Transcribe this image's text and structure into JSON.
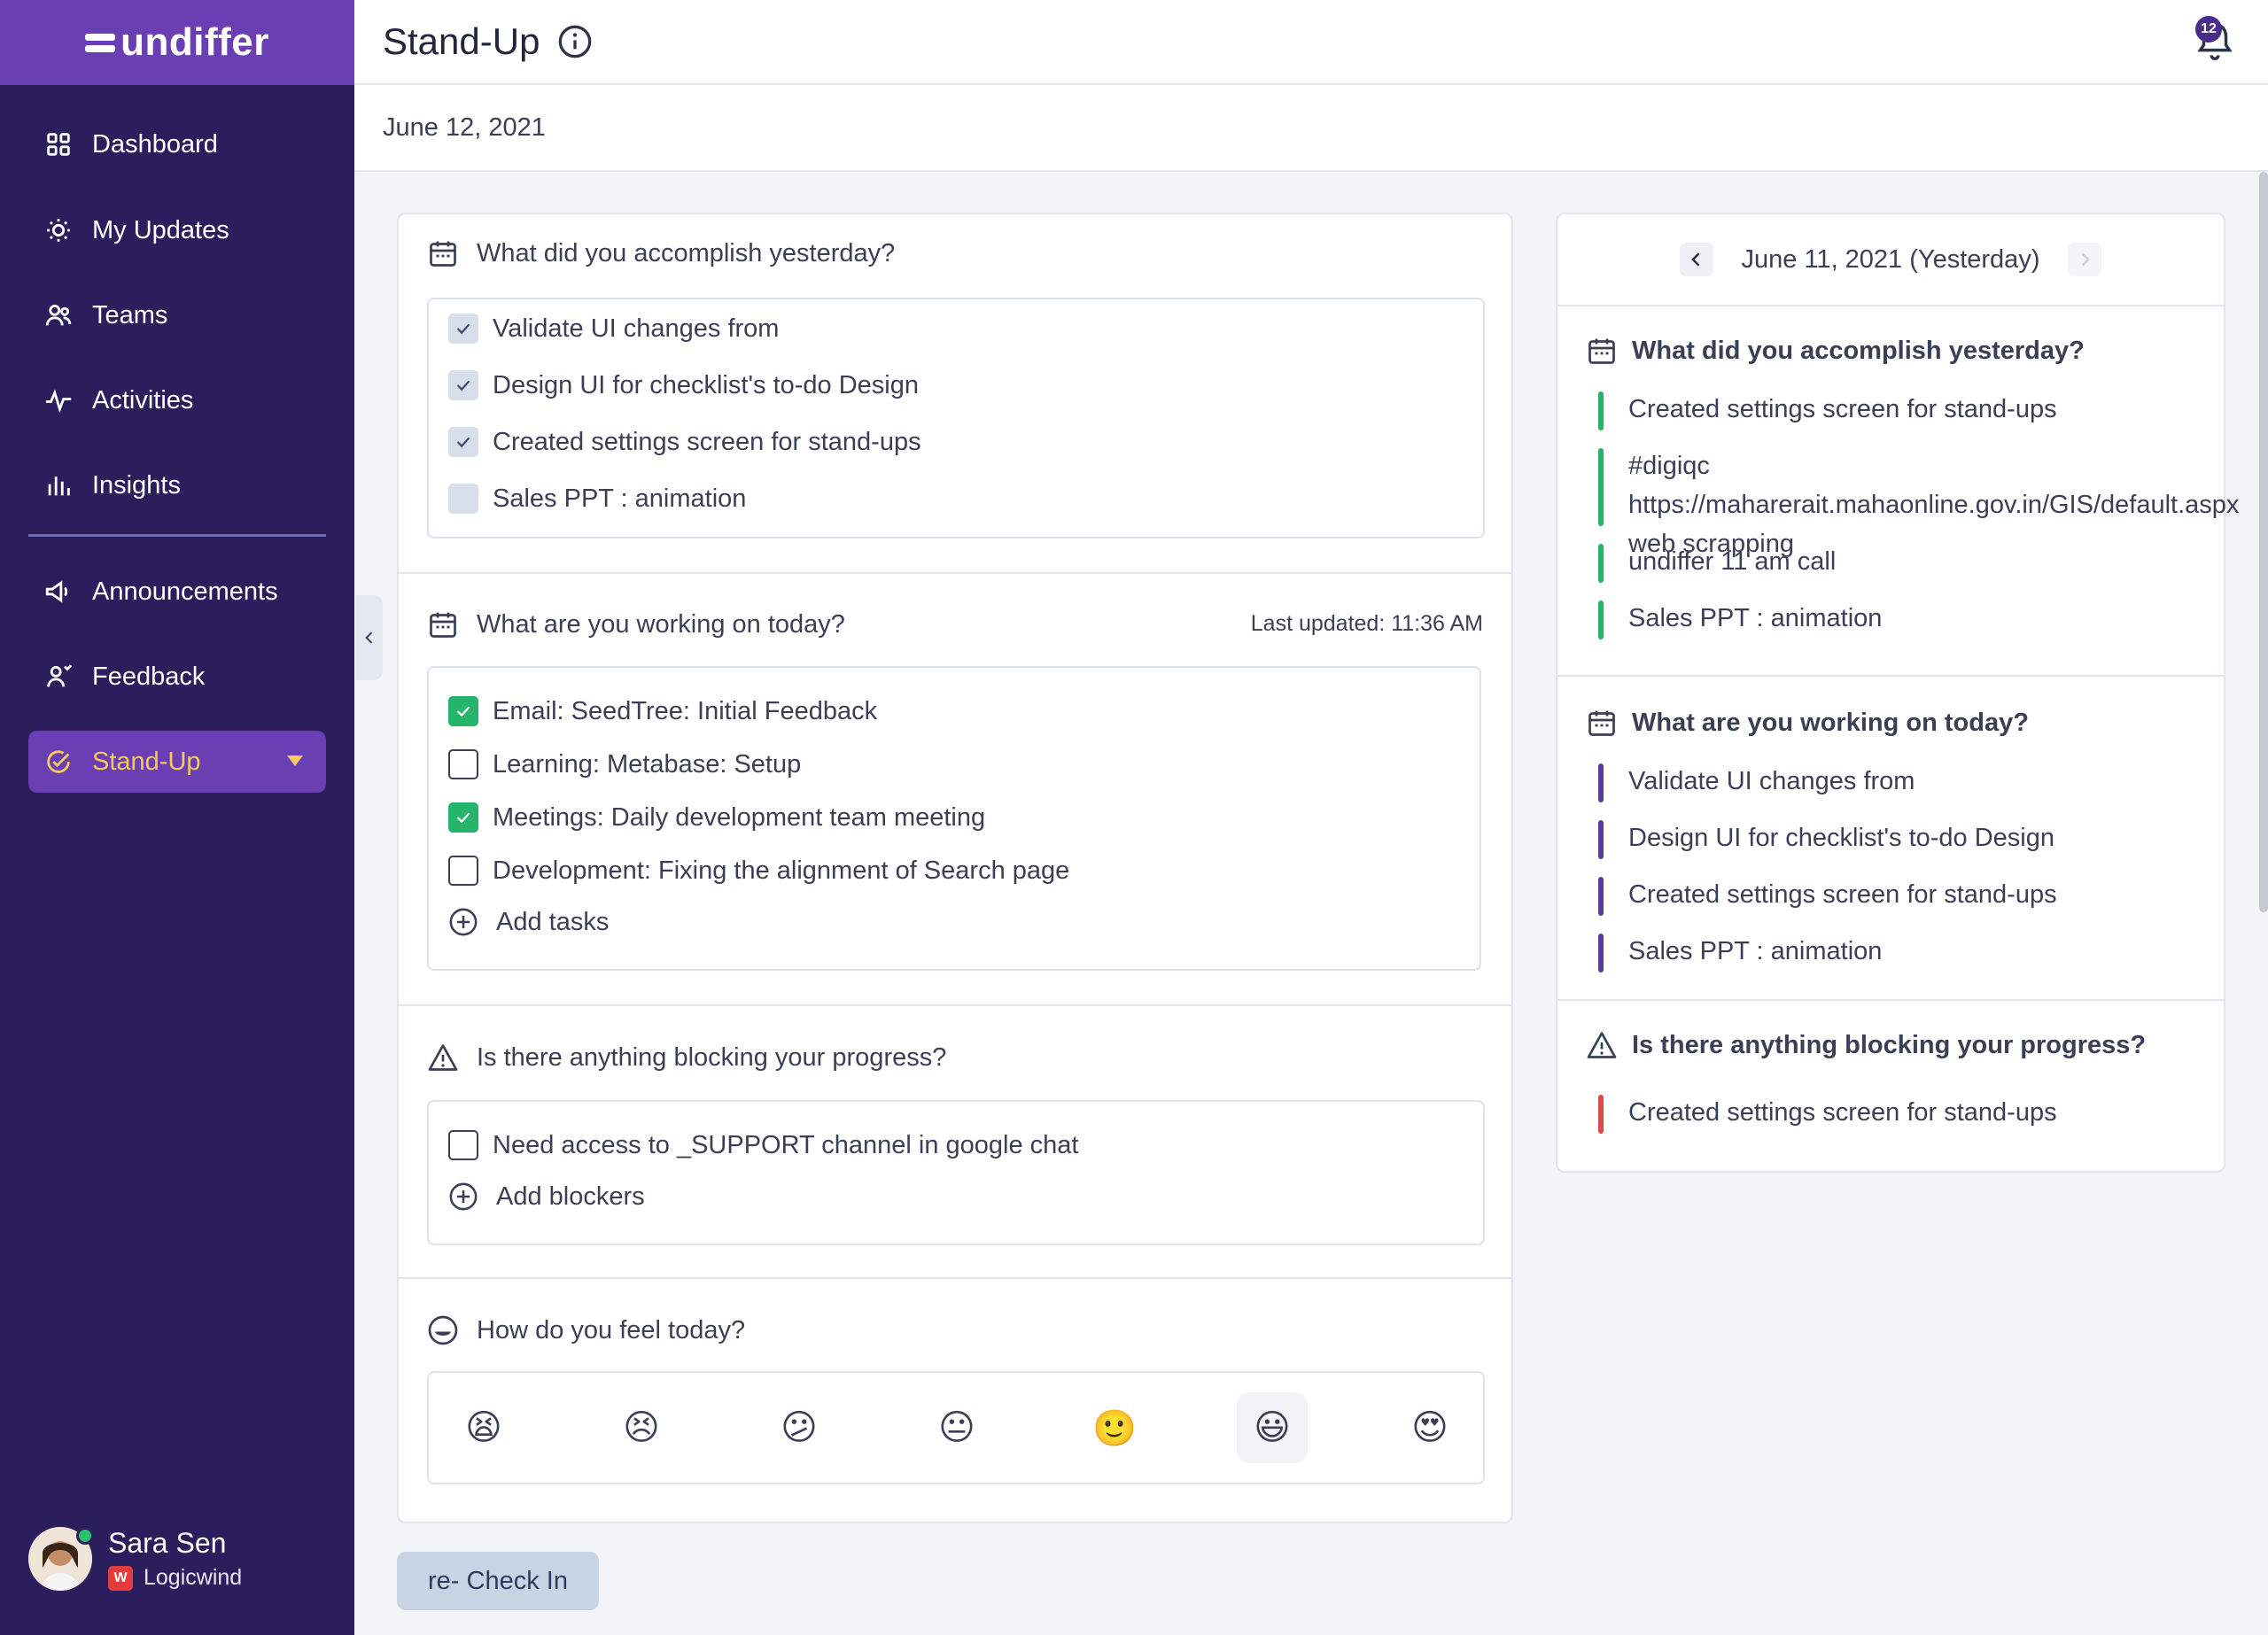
{
  "brand": {
    "name": "undiffer"
  },
  "sidebar": {
    "items": [
      {
        "label": "Dashboard",
        "icon": "grid-icon"
      },
      {
        "label": "My Updates",
        "icon": "bulb-icon"
      },
      {
        "label": "Teams",
        "icon": "users-icon"
      },
      {
        "label": "Activities",
        "icon": "pulse-icon"
      },
      {
        "label": "Insights",
        "icon": "bar-chart-icon"
      },
      {
        "label": "Announcements",
        "icon": "megaphone-icon"
      },
      {
        "label": "Feedback",
        "icon": "feedback-icon"
      },
      {
        "label": "Stand-Up",
        "icon": "check-circle-icon"
      }
    ],
    "active_item": "Stand-Up",
    "active_color": "#f6c95a",
    "user": {
      "name": "Sara Sen",
      "org": "Logicwind",
      "status": "online"
    }
  },
  "header": {
    "title": "Stand-Up",
    "notification_count": "12"
  },
  "date": "June 12, 2021",
  "main": {
    "accomplished": {
      "title": "What did you accomplish yesterday?",
      "items": [
        {
          "label": "Validate UI changes from",
          "checked": true
        },
        {
          "label": "Design UI for checklist's to-do Design",
          "checked": true
        },
        {
          "label": "Created settings screen for stand-ups",
          "checked": true
        },
        {
          "label": "Sales PPT : animation",
          "checked": false
        }
      ]
    },
    "working": {
      "title": "What are you working on today?",
      "last_updated": "Last updated: 11:36 AM",
      "items": [
        {
          "label": "Email: SeedTree: Initial Feedback",
          "checked": true
        },
        {
          "label": "Learning: Metabase: Setup",
          "checked": false
        },
        {
          "label": "Meetings: Daily development team meeting",
          "checked": true
        },
        {
          "label": "Development: Fixing the alignment of Search page",
          "checked": false
        }
      ],
      "add_label": "Add tasks"
    },
    "blocking": {
      "title": "Is there anything blocking your progress?",
      "items": [
        {
          "label": "Need access to _SUPPORT channel in google chat",
          "checked": false
        }
      ],
      "add_label": "Add blockers"
    },
    "feeling": {
      "title": "How do you feel today?",
      "emojis": [
        "😫",
        "😣",
        "😕",
        "😐",
        "🙂",
        "😃",
        "😍"
      ],
      "selected_index": 5
    },
    "recheck_label": "re- Check In"
  },
  "yesterday": {
    "label": "June 11, 2021 (Yesterday)",
    "accomplished": {
      "title": "What did you accomplish yesterday?",
      "items": [
        "Created settings screen for stand-ups",
        "#digiqc https://maharerait.mahaonline.gov.in/GIS/default.aspx web scrapping",
        "undiffer 11 am call",
        "Sales PPT : animation"
      ]
    },
    "working": {
      "title": "What are you working on today?",
      "items": [
        "Validate UI changes from",
        "Design UI for checklist's to-do Design",
        "Created settings screen for stand-ups",
        "Sales PPT : animation"
      ]
    },
    "blocking": {
      "title": "Is there anything blocking your progress?",
      "items": [
        "Created settings screen for stand-ups"
      ]
    }
  },
  "colors": {
    "brand_purple": "#6a3fb3",
    "sidebar_bg": "#2a1f5c",
    "check_green": "#26b36a",
    "blocker_red": "#e04848"
  }
}
